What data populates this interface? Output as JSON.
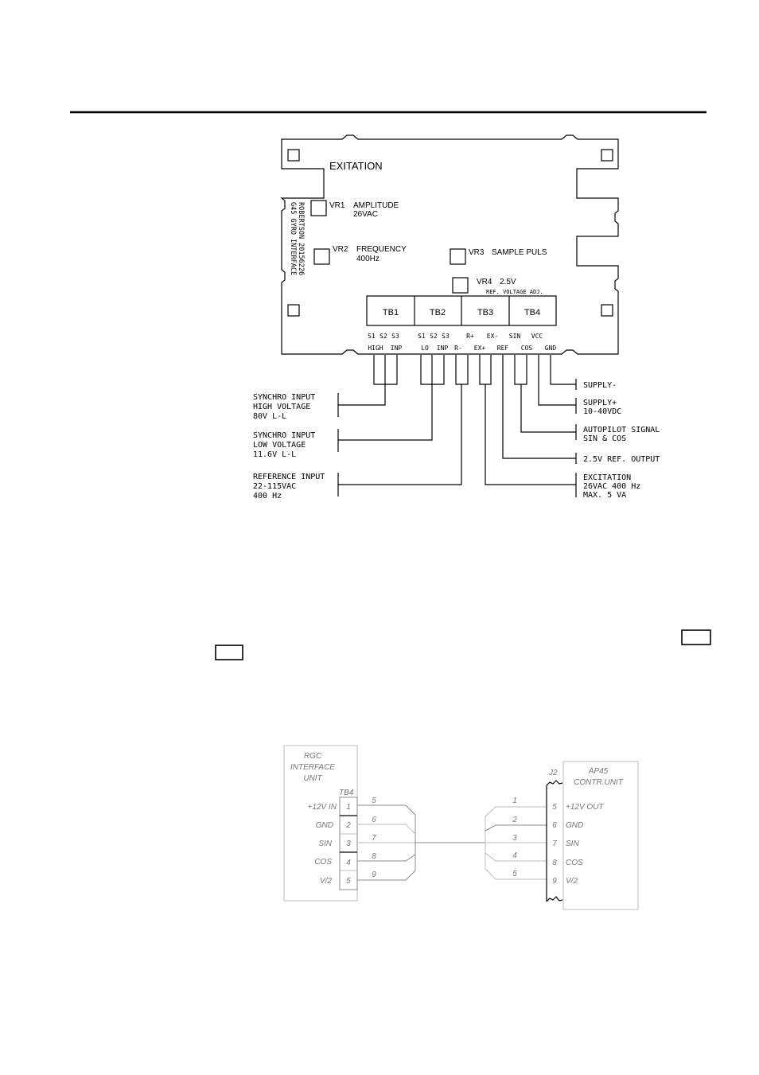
{
  "page": {
    "header_rule": true
  },
  "board": {
    "title_exitation": "EXITATION",
    "side_text_line1": "G45 GYRO INTERFACE",
    "side_text_line2": "ROBERTSON 20156226",
    "vr1": {
      "label": "VR1",
      "name": "AMPLITUDE",
      "value": "26VAC"
    },
    "vr2": {
      "label": "VR2",
      "name": "FREQUENCY",
      "value": "400Hz"
    },
    "vr3": {
      "label": "VR3",
      "name": "SAMPLE PULS"
    },
    "vr4": {
      "label": "VR4",
      "name": "2.5V",
      "sub": "REF. VOLTAGE ADJ."
    },
    "terminal_blocks": [
      "TB1",
      "TB2",
      "TB3",
      "TB4"
    ],
    "pins_row1": [
      "S1",
      "S2",
      "S3",
      "S1",
      "S2",
      "S3",
      "R+",
      "EX-",
      "SIN",
      "VCC"
    ],
    "pins_row2": [
      "HIGH",
      "INP",
      "LO",
      "INP",
      "R-",
      "EX+",
      "REF",
      "COS",
      "GND"
    ]
  },
  "left_callouts": [
    {
      "lines": [
        "SYNCHRO INPUT",
        "HIGH VOLTAGE",
        "80V L-L"
      ]
    },
    {
      "lines": [
        "SYNCHRO INPUT",
        "LOW VOLTAGE",
        "11.6V L-L"
      ]
    },
    {
      "lines": [
        "REFERENCE INPUT",
        "22-115VAC",
        "400 Hz"
      ]
    }
  ],
  "right_callouts": [
    {
      "lines": [
        "SUPPLY-"
      ]
    },
    {
      "lines": [
        "SUPPLY+",
        "10-40VDC"
      ]
    },
    {
      "lines": [
        "AUTOPILOT SIGNAL",
        "SIN & COS"
      ]
    },
    {
      "lines": [
        "2.5V REF. OUTPUT"
      ]
    },
    {
      "lines": [
        "EXCITATION",
        "26VAC 400 Hz",
        "MAX. 5 VA"
      ]
    }
  ],
  "wiring": {
    "left_unit": {
      "title": [
        "RGC",
        "INTERFACE",
        "UNIT"
      ],
      "connector": "TB4",
      "signals": [
        "+12V IN",
        "GND",
        "SIN",
        "COS",
        "V/2"
      ],
      "terminals": [
        "1",
        "2",
        "3",
        "4",
        "5"
      ],
      "wire_numbers": [
        "5",
        "6",
        "7",
        "8",
        "9"
      ]
    },
    "right_unit": {
      "title": [
        "AP45",
        "CONTR.UNIT"
      ],
      "connector": "J2",
      "signals": [
        "+12V OUT",
        "GND",
        "SIN",
        "COS",
        "V/2"
      ],
      "terminals": [
        "5",
        "6",
        "7",
        "8",
        "9"
      ],
      "wire_numbers": [
        "1",
        "2",
        "3",
        "4",
        "5"
      ]
    }
  }
}
